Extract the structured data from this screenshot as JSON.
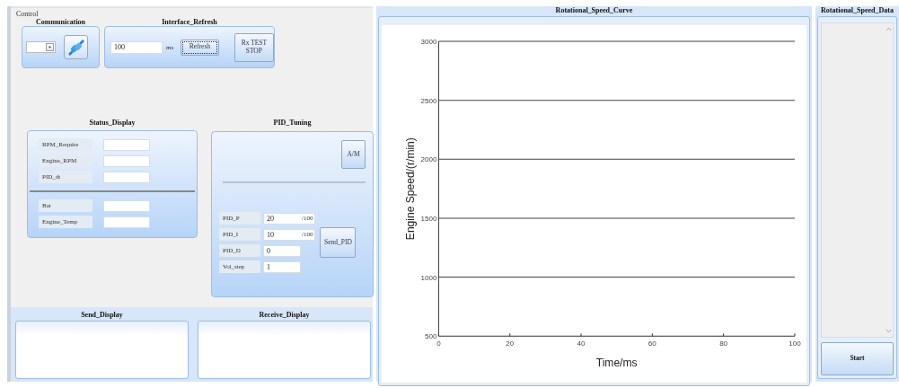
{
  "control": {
    "title": "Control",
    "communication": {
      "title": "Communication"
    },
    "interface_refresh": {
      "title": "Interface_Refresh",
      "interval": "100",
      "unit": "ms",
      "buttons": [
        {
          "label": "Refresh",
          "focused": true
        },
        {
          "label": "Rx TEST STOP",
          "focused": false
        }
      ]
    },
    "status_display": {
      "title": "Status_Display",
      "groups": [
        [
          {
            "label": "RPM_Require"
          },
          {
            "label": "Engine_RPM"
          },
          {
            "label": "PID_dt"
          }
        ],
        [
          {
            "label": "Bat"
          },
          {
            "label": "Engine_Temp"
          }
        ]
      ]
    },
    "pid_tuning": {
      "title": "PID_Tuning",
      "mode_button": "A/M",
      "params": [
        {
          "label": "PID_P",
          "value": "20",
          "unit": "/100"
        },
        {
          "label": "PID_I",
          "value": "10",
          "unit": "/100"
        },
        {
          "label": "PID_D",
          "value": "0"
        },
        {
          "label": "Vol_step",
          "value": "1"
        }
      ],
      "send_button": "Send_PID"
    }
  },
  "send_display": {
    "title": "Send_Display"
  },
  "receive_display": {
    "title": "Receive_Display"
  },
  "speed_curve": {
    "title": "Rotational_Speed_Curve",
    "chart_data": {
      "type": "line",
      "xlabel": "Time/ms",
      "ylabel": "Engine Speed/(r/min)",
      "xlim": [
        0,
        100
      ],
      "ylim": [
        500,
        3000
      ],
      "xticks": [
        0,
        20,
        40,
        60,
        80,
        100
      ],
      "yticks": [
        500,
        1000,
        1500,
        2000,
        2500,
        3000
      ],
      "grid": true
    }
  },
  "speed_data": {
    "title": "Rotational_Speed_Data",
    "button": "Start"
  }
}
